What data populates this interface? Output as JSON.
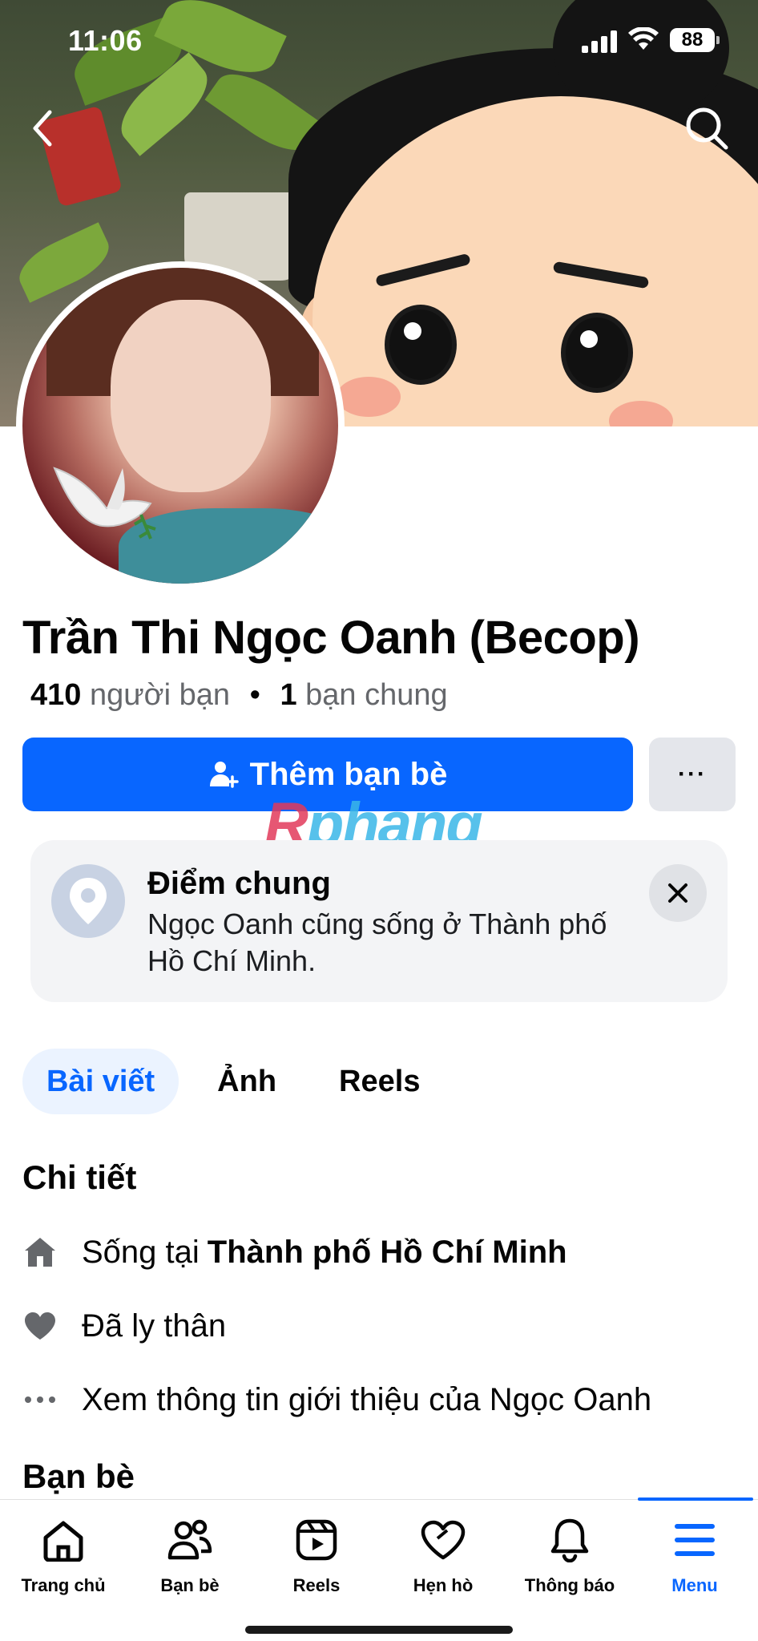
{
  "status_bar": {
    "time": "11:06",
    "battery": "88"
  },
  "profile": {
    "name": "Trần Thi Ngọc Oanh (Becop)",
    "friends_count": "410",
    "friends_label": "người bạn",
    "mutual_count": "1",
    "mutual_label": "bạn chung"
  },
  "actions": {
    "add_friend_label": "Thêm bạn bè",
    "more_label": "···"
  },
  "watermark": {
    "part1": "R",
    "part2": "phang"
  },
  "common_card": {
    "title": "Điểm chung",
    "text": "Ngọc Oanh cũng sống ở Thành phố Hồ Chí Minh."
  },
  "tabs": [
    {
      "label": "Bài viết",
      "active": true
    },
    {
      "label": "Ảnh",
      "active": false
    },
    {
      "label": "Reels",
      "active": false
    }
  ],
  "details": {
    "title": "Chi tiết",
    "lives_prefix": "Sống tại",
    "lives_city": "Thành phố Hồ Chí Minh",
    "relationship": "Đã ly thân",
    "see_intro": "Xem thông tin giới thiệu của Ngọc Oanh"
  },
  "friends_section": {
    "title": "Bạn bè"
  },
  "bottom_nav": [
    {
      "label": "Trang chủ",
      "icon": "home-icon"
    },
    {
      "label": "Bạn bè",
      "icon": "friends-icon"
    },
    {
      "label": "Reels",
      "icon": "reels-icon"
    },
    {
      "label": "Hẹn hò",
      "icon": "dating-heart-icon"
    },
    {
      "label": "Thông báo",
      "icon": "bell-icon"
    },
    {
      "label": "Menu",
      "icon": "menu-icon",
      "active": true
    }
  ],
  "colors": {
    "accent": "#0866ff",
    "secondary_text": "#65676b",
    "card_bg": "#f3f4f6"
  }
}
